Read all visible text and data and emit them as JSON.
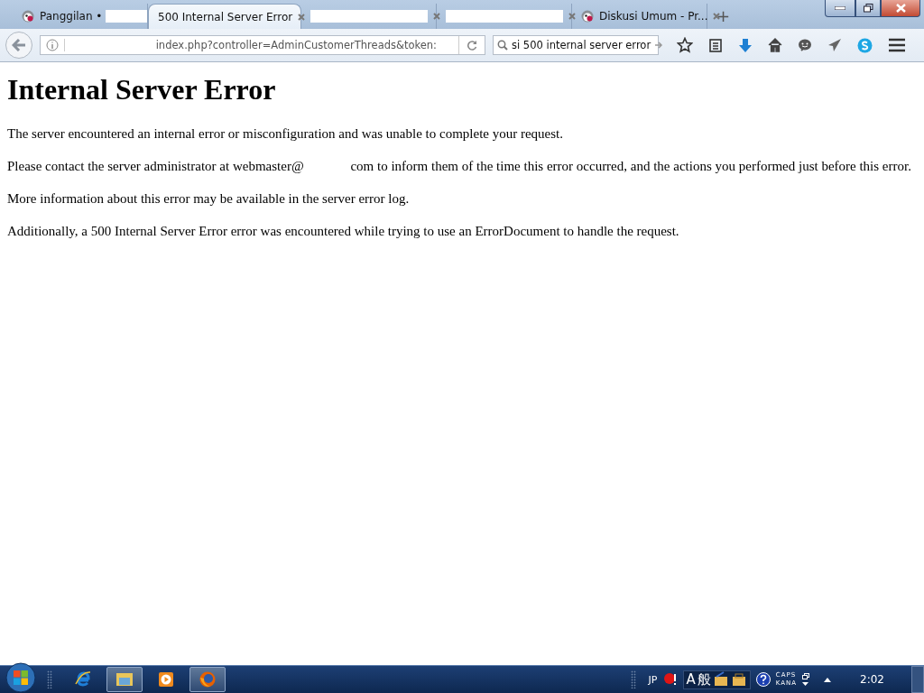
{
  "tabs": [
    {
      "title": "Panggilan •",
      "tail_redacted": true,
      "favicon": true,
      "selected": false
    },
    {
      "title": "500 Internal Server Error",
      "tail_redacted": false,
      "favicon": false,
      "selected": true
    },
    {
      "tail_redacted": false,
      "favicon": false,
      "selected": false
    },
    {
      "tail_redacted": false,
      "favicon": false,
      "selected": false
    },
    {
      "title": "Diskusi Umum - Pr...",
      "tail_redacted": false,
      "favicon": true,
      "selected": false
    }
  ],
  "new_tab": "+",
  "address": {
    "value": "index.php?controller=AdminCustomerThreads&token:"
  },
  "search": {
    "value": "si 500 internal server error"
  },
  "page": {
    "heading": "Internal Server Error",
    "paragraphs": [
      {
        "before": "The server encountered an internal error or misconfiguration and was unable to complete your request."
      },
      {
        "before": "Please contact the server administrator at webmaster@",
        "after": "com to inform them of the time this error occurred, and the actions you performed just before this error."
      },
      {
        "before": "More information about this error may be available in the server error log."
      },
      {
        "before": "Additionally, a 500 Internal Server Error error was encountered while trying to use an ErrorDocument to handle the request."
      }
    ]
  },
  "taskbar": {
    "apps": [
      {
        "kind": "ie",
        "active": false
      },
      {
        "kind": "explorer",
        "active": true
      },
      {
        "kind": "media",
        "active": false
      },
      {
        "kind": "firefox",
        "active": true
      }
    ],
    "language": "JP",
    "ime_mode": "A",
    "ime_kanji": "般",
    "caps": "CAPS",
    "kana": "KANA",
    "clock": "2:02"
  }
}
